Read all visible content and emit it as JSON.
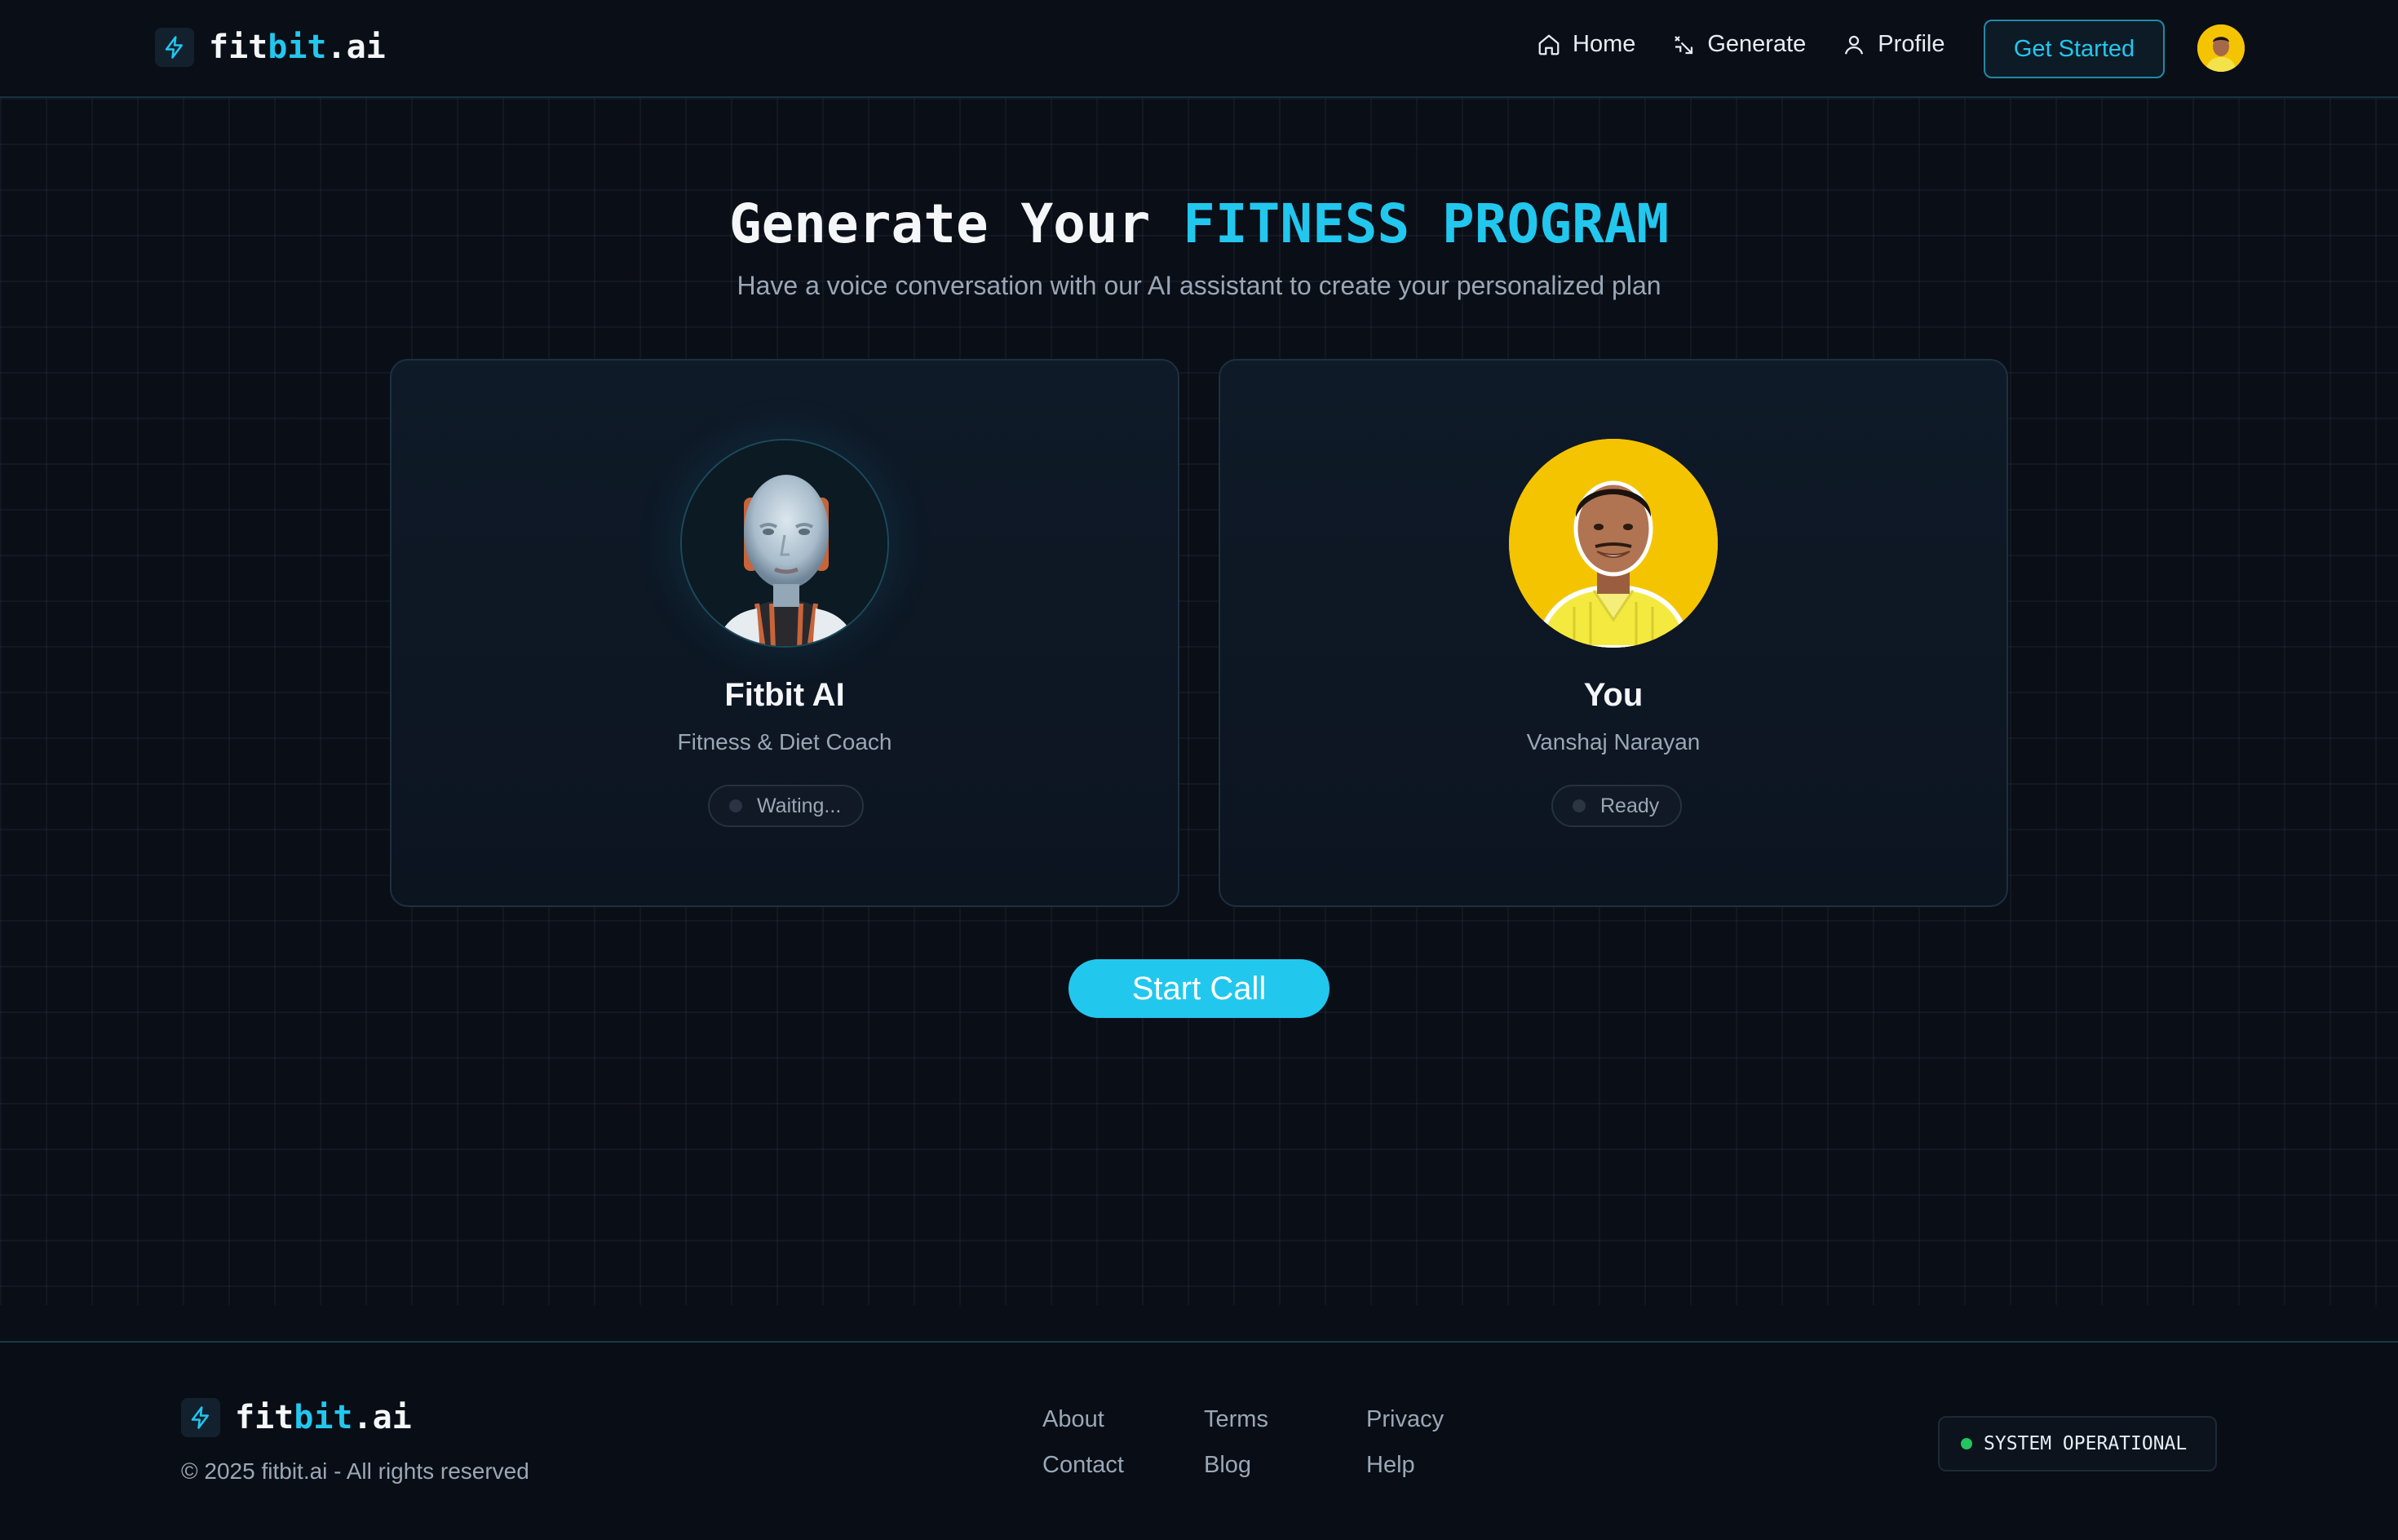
{
  "nav": {
    "logo": {
      "prefix": "fit",
      "accent": "bit",
      "suffix": ".ai",
      "icon": "bolt-icon"
    },
    "links": [
      {
        "label": "Home",
        "icon": "home-icon"
      },
      {
        "label": "Generate",
        "icon": "generate-icon"
      },
      {
        "label": "Profile",
        "icon": "user-icon"
      }
    ],
    "cta_label": "Get Started"
  },
  "hero": {
    "title_plain": "Generate Your ",
    "title_accent": "FITNESS PROGRAM",
    "subtitle": "Have a voice conversation with our AI assistant to create your personalized plan"
  },
  "cards": {
    "ai": {
      "name": "Fitbit AI",
      "role": "Fitness & Diet Coach",
      "status": "Waiting..."
    },
    "user": {
      "name": "You",
      "role": "Vanshaj Narayan",
      "status": "Ready"
    }
  },
  "call_button": "Start Call",
  "footer": {
    "logo": {
      "prefix": "fit",
      "accent": "bit",
      "suffix": ".ai"
    },
    "copyright": "© 2025 fitbit.ai - All rights reserved",
    "links": [
      "About",
      "Terms",
      "Privacy",
      "Contact",
      "Blog",
      "Help"
    ],
    "status": "SYSTEM OPERATIONAL"
  },
  "colors": {
    "accent": "#22c7ee",
    "background": "#0a0e17",
    "status_ok": "#22c55e",
    "avatar_bg": "#f5c400"
  }
}
